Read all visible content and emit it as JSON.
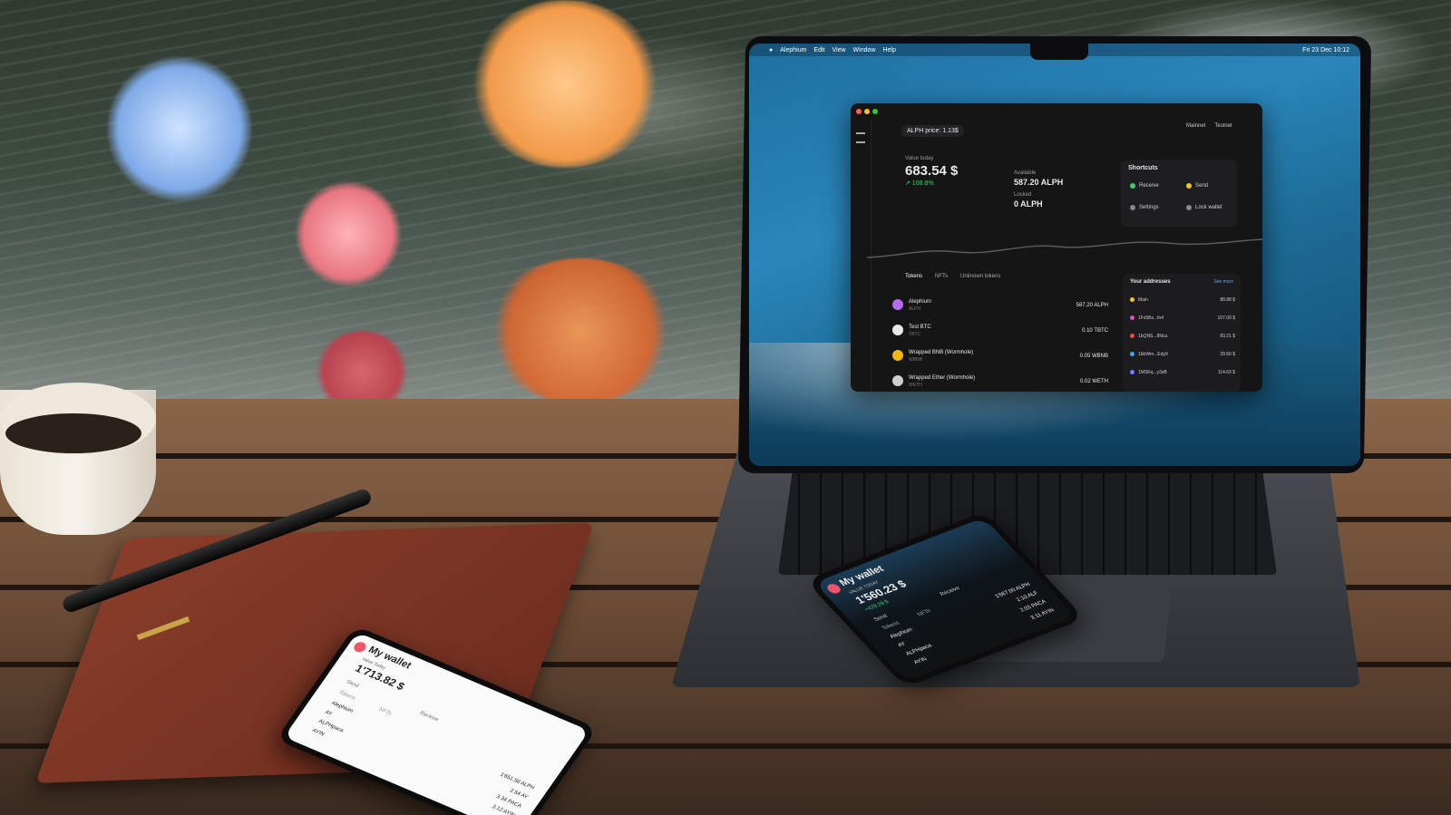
{
  "laptop": {
    "menubar": {
      "app_name": "Alephium",
      "items": [
        "Edit",
        "View",
        "Window",
        "Help"
      ],
      "clock": "Fri 23 Dec 10:12"
    },
    "wallet_app": {
      "price_pill": "ALPH price: 1.13$",
      "value_label": "Value today",
      "value_total": "683.54 $",
      "value_delta": "↗ 108.8%",
      "available_label": "Available",
      "available_value": "587.20 ALPH",
      "locked_label": "Locked",
      "locked_value": "0 ALPH",
      "header_items": [
        "Mainnet",
        "Testnet"
      ],
      "shortcuts": {
        "title": "Shortcuts",
        "items": [
          "Receive",
          "Send",
          "Settings",
          "Lock wallet"
        ]
      },
      "tabs": [
        "Tokens",
        "NFTs",
        "Unknown tokens"
      ],
      "tokens": [
        {
          "name": "Alephium",
          "symbol": "ALPH",
          "amount": "587.20 ALPH",
          "color": "#b56cf0"
        },
        {
          "name": "Test BTC",
          "symbol": "TBTC",
          "amount": "0.10 TBTC",
          "color": "#e8e8e8"
        },
        {
          "name": "Wrapped BNB (Wormhole)",
          "symbol": "WBNB",
          "amount": "0.05 WBNB",
          "color": "#f0b90b"
        },
        {
          "name": "Wrapped Ether (Wormhole)",
          "symbol": "WETH",
          "amount": "0.02 WETH",
          "color": "#cfcfd2"
        }
      ],
      "addresses": {
        "title": "Your addresses",
        "see_more": "See more",
        "rows": [
          {
            "label": "Main",
            "value": "88.88 $",
            "color": "#f3c42b"
          },
          {
            "label": "1Fx5Bs...fn4",
            "value": "107.00 $",
            "color": "#e94bd0"
          },
          {
            "label": "1bQNS...8Ncu",
            "value": "83.21 $",
            "color": "#ef4b4b"
          },
          {
            "label": "1bbWm...Edy9",
            "value": "29.60 $",
            "color": "#3ea0ff"
          },
          {
            "label": "1MSKq...y3sB",
            "value": "114.63 $",
            "color": "#7a7aff"
          }
        ]
      }
    }
  },
  "phone_light": {
    "title": "My wallet",
    "value_label": "Value Today",
    "value_total": "1'713.82 $",
    "buttons": [
      "Send",
      "Receive"
    ],
    "tabs": [
      "Tokens",
      "NFTs"
    ],
    "rows": [
      {
        "name": "Alephium",
        "amount": "1'651.50 ALPH"
      },
      {
        "name": "AY",
        "amount": "2.54 AY"
      },
      {
        "name": "ALPHpaca",
        "amount": "3.34 PACA"
      },
      {
        "name": "AYIN",
        "amount": "3.12 AYIN"
      }
    ]
  },
  "phone_dark": {
    "title": "My wallet",
    "value_label": "VALUE TODAY",
    "value_total": "1'560.23 $",
    "value_delta": "+429.29 $",
    "buttons": [
      "Send",
      "Receive"
    ],
    "tabs": [
      "Tokens",
      "NFTs"
    ],
    "rows": [
      {
        "name": "Alephium",
        "amount": "1'667.00 ALPH"
      },
      {
        "name": "AY",
        "amount": "2.10 ALF"
      },
      {
        "name": "ALPHpaca",
        "amount": "2.03 PACA"
      },
      {
        "name": "AYIN",
        "amount": "3.11 AYIN"
      }
    ]
  }
}
